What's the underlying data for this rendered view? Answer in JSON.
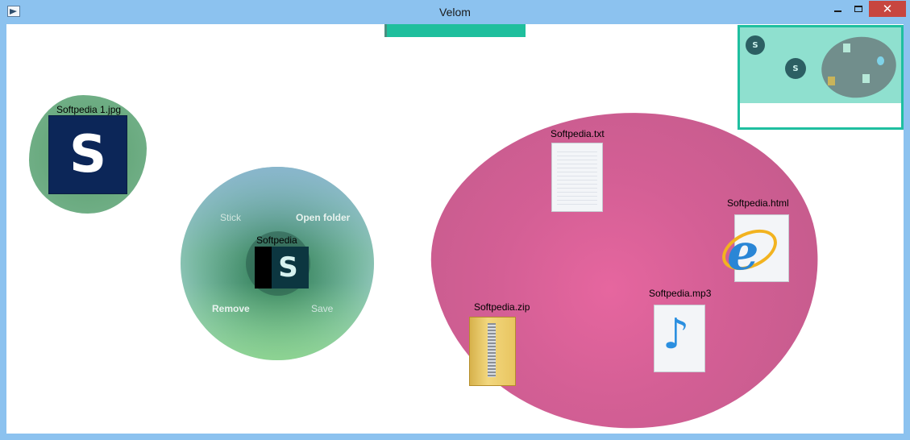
{
  "window": {
    "title": "Velom",
    "close_glyph": "✕"
  },
  "items": {
    "jpg": {
      "label": "Softpedia 1.jpg",
      "thumb_letter": "S"
    },
    "selected": {
      "label": "Softpedia",
      "thumb_letter": "S"
    },
    "txt": {
      "label": "Softpedia.txt"
    },
    "html": {
      "label": "Softpedia.html",
      "icon_letter": "e"
    },
    "zip": {
      "label": "Softpedia.zip"
    },
    "mp3": {
      "label": "Softpedia.mp3",
      "icon_glyph": "♪"
    }
  },
  "radial_menu": {
    "stick": "Stick",
    "open_folder": "Open folder",
    "remove": "Remove",
    "save": "Save"
  },
  "minimap": {
    "dot_letter": "S"
  },
  "colors": {
    "accent": "#1fbf9d",
    "pink_group": "#d45f95",
    "green_group": "#72b088",
    "close": "#c7463f"
  },
  "icons": {
    "app": "window-icon",
    "minimize": "minimize-icon",
    "maximize": "maximize-icon",
    "close": "close-icon"
  }
}
